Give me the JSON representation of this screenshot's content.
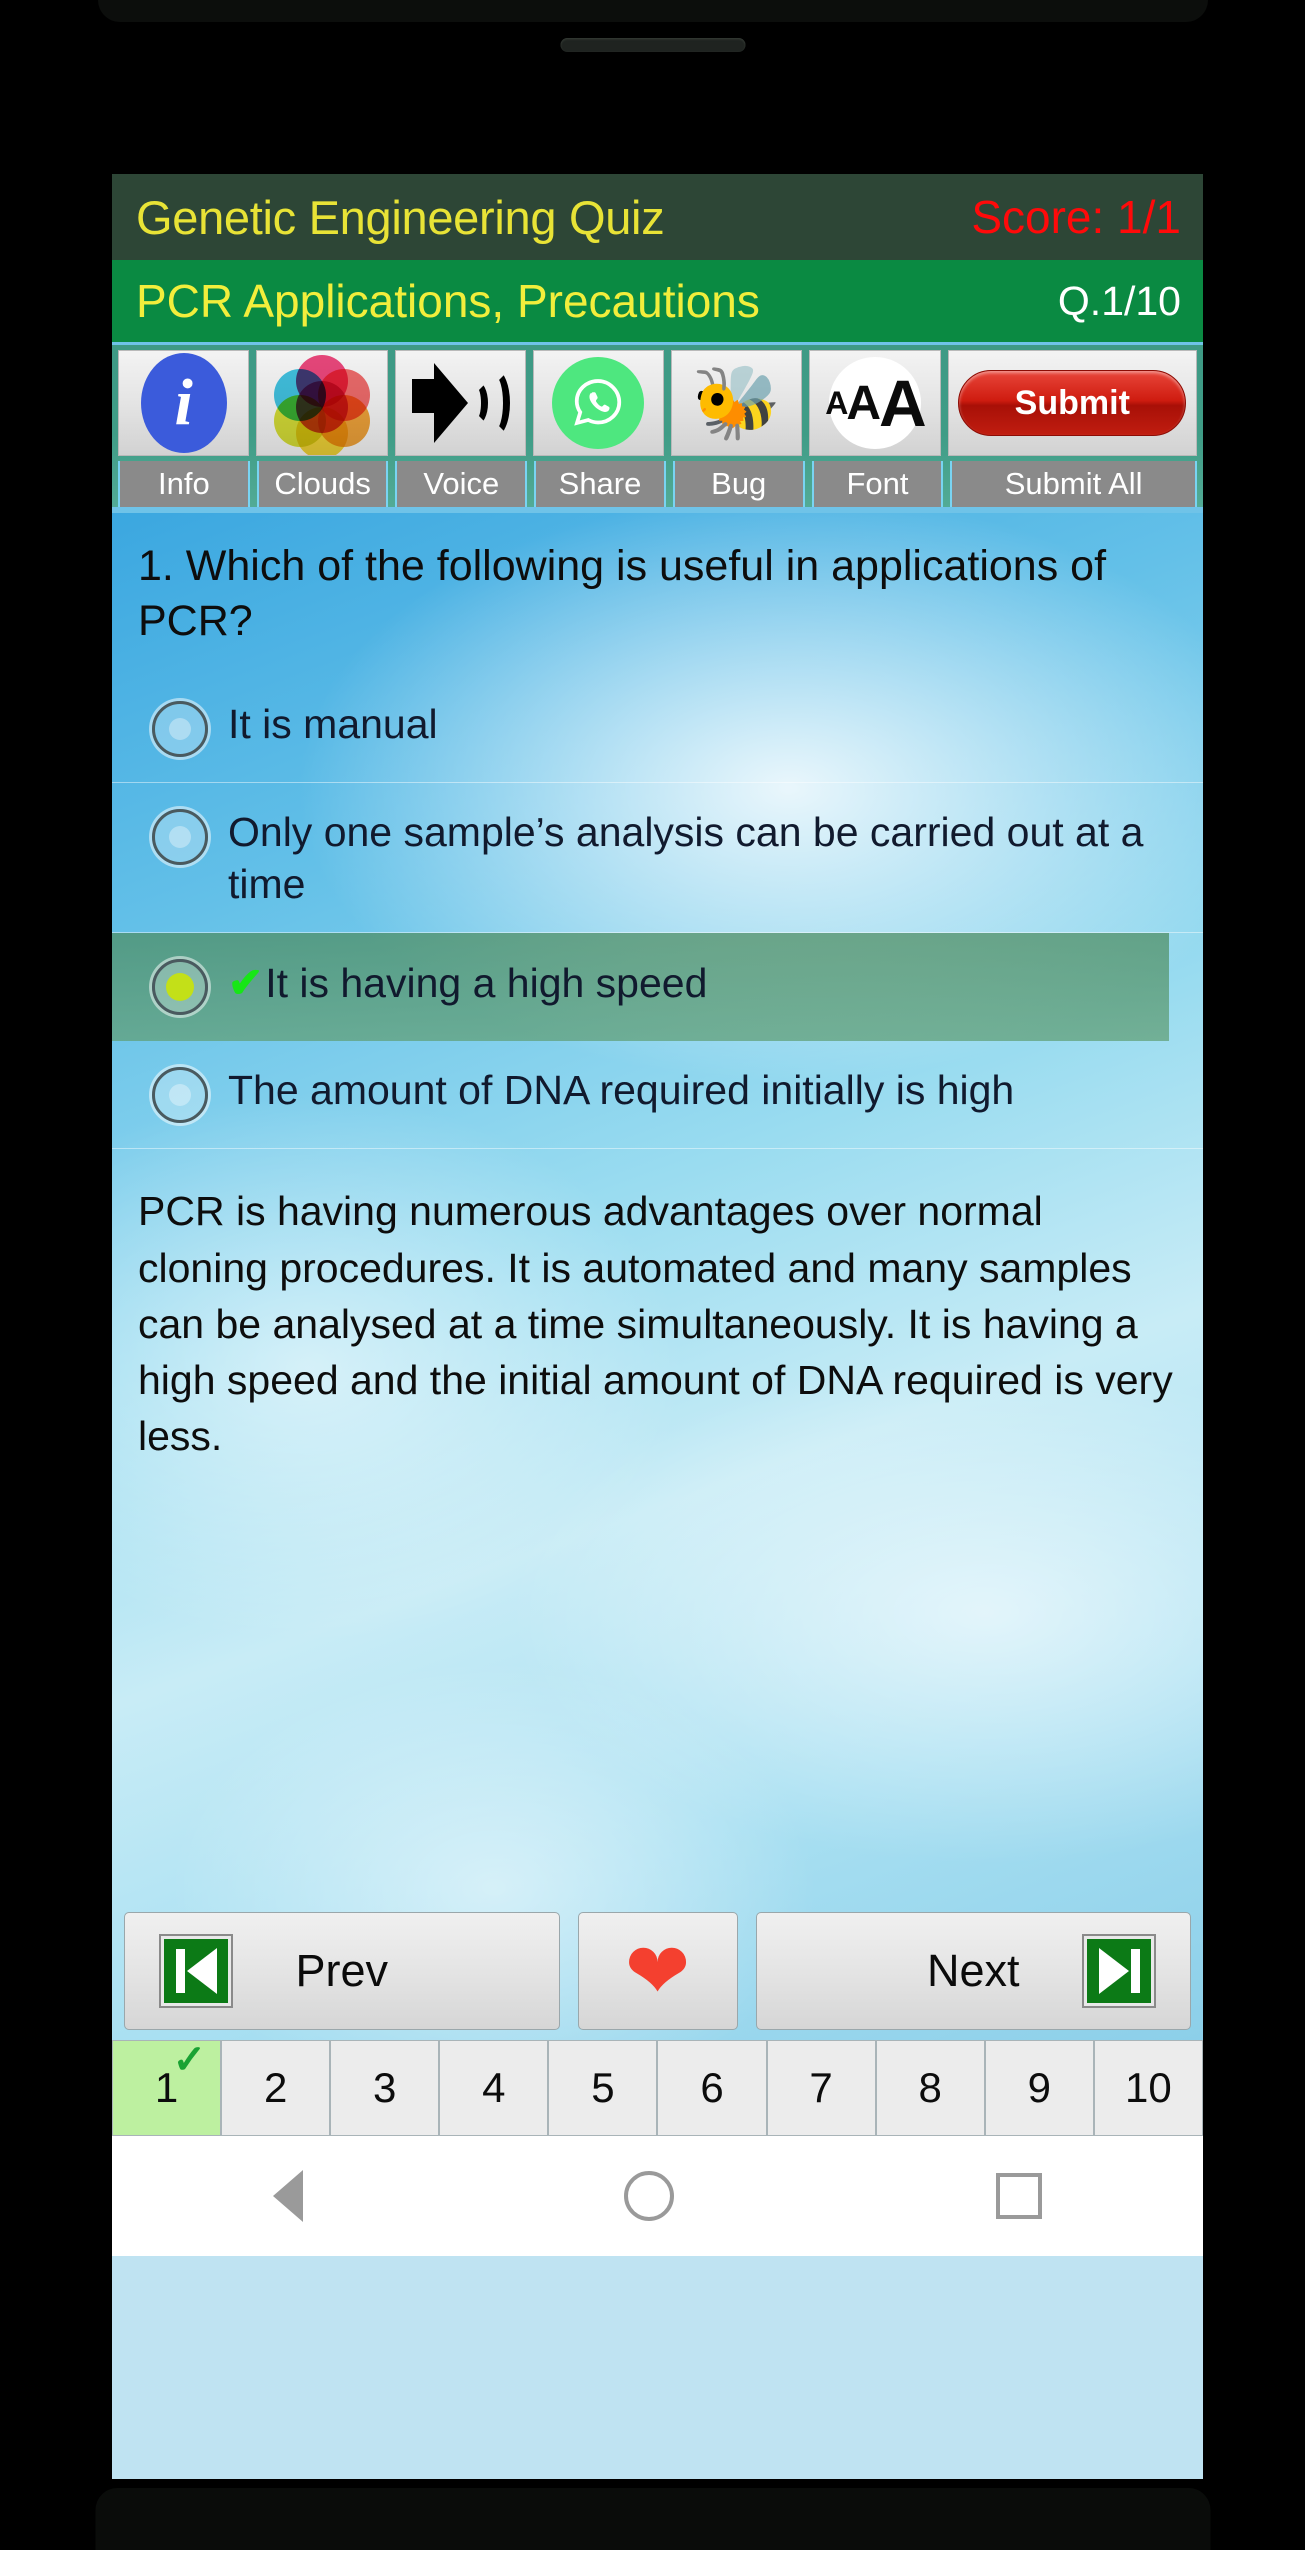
{
  "app": {
    "title": "Genetic Engineering Quiz",
    "score": "Score: 1/1",
    "topic": "PCR Applications, Precautions",
    "question_counter": "Q.1/10"
  },
  "toolbar": {
    "items": [
      {
        "icon": "info-icon",
        "label": "Info"
      },
      {
        "icon": "clouds-icon",
        "label": "Clouds"
      },
      {
        "icon": "speaker-icon",
        "label": "Voice"
      },
      {
        "icon": "whatsapp-share-icon",
        "label": "Share"
      },
      {
        "icon": "ladybug-icon",
        "label": "Bug"
      },
      {
        "icon": "font-size-icon",
        "label": "Font"
      }
    ],
    "submit_button": "Submit",
    "submit_all_label": "Submit All"
  },
  "question": {
    "number": "1.",
    "text": "1. Which of the following is useful in applications of PCR?",
    "options": [
      {
        "label": "It is manual",
        "selected": false,
        "correct": false
      },
      {
        "label": "Only one sample’s analysis can be carried out at a time",
        "selected": false,
        "correct": false
      },
      {
        "label": "It is having a high speed",
        "selected": true,
        "correct": true
      },
      {
        "label": "The amount of DNA required initially is high",
        "selected": false,
        "correct": false
      }
    ],
    "explanation": "PCR is having numerous advantages over normal cloning procedures. It is automated and many samples can be analysed at a time simultaneously. It is having a high speed and the initial amount of DNA required is very less."
  },
  "nav": {
    "prev_label": "Prev",
    "next_label": "Next",
    "favorite_icon": "heart-icon",
    "prev_icon": "skip-to-start-icon",
    "next_icon": "skip-to-end-icon"
  },
  "pager": {
    "pages": [
      "1",
      "2",
      "3",
      "4",
      "5",
      "6",
      "7",
      "8",
      "9",
      "10"
    ],
    "active_index": 0,
    "answered_check": "✓"
  },
  "system_nav": {
    "back": "back-triangle-icon",
    "home": "home-circle-icon",
    "recents": "recents-square-icon"
  },
  "colors": {
    "title_bar_bg": "#2d4636",
    "title_text": "#e8e336",
    "score_text": "#ff0a0a",
    "topic_bar_bg": "#0a8a42",
    "topic_text": "#f2ee3c",
    "counter_text": "#ffffff",
    "toolbar_bg": "#3f9c86",
    "toolbar_label_bg": "#8a8a8a",
    "submit_red": "#c01d10",
    "selected_option_bg": "#4c8c60",
    "selected_radio_dot": "#c3e018",
    "tick_green": "#17e617",
    "pager_active_bg": "#bdf0a0",
    "pager_check": "#1aa233"
  }
}
